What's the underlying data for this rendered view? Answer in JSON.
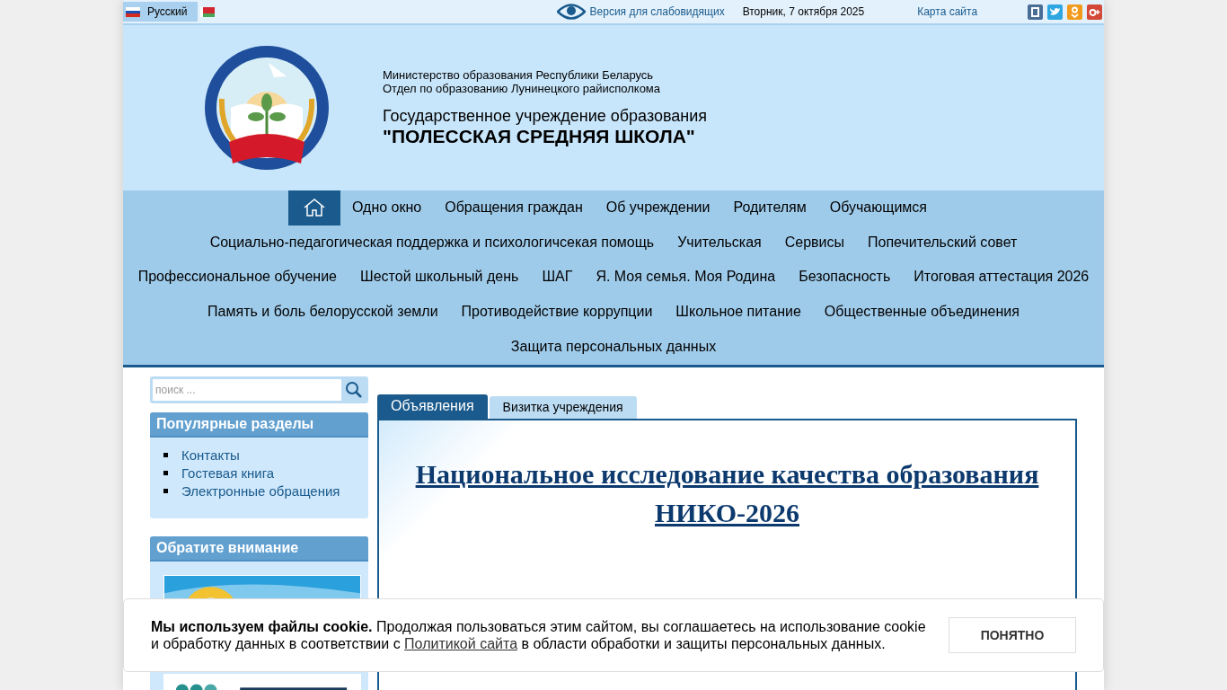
{
  "top_bar": {
    "languages": [
      {
        "label": "Русский",
        "selected": true
      },
      {
        "selected": false
      }
    ],
    "accessibility_link": "Версия для слабовидящих",
    "date": "Вторник, 7 октября 2025",
    "sitemap_link": "Карта сайта"
  },
  "header": {
    "ministry": "Министерство образования Республики Беларусь",
    "department": "Отдел по образованию Лунинецкого райисполкома",
    "institution": "Государственное учреждение образования",
    "school_name": "\"ПОЛЕССКАЯ СРЕДНЯЯ ШКОЛА\""
  },
  "nav": {
    "items": [
      {
        "kind": "home",
        "selected": true
      },
      {
        "label": "Одно окно",
        "selected": false
      },
      {
        "label": "Обращения граждан",
        "selected": false
      },
      {
        "label": "Об учреждении",
        "selected": false
      },
      {
        "label": "Родителям",
        "selected": false
      },
      {
        "label": "Обучающимся",
        "selected": false
      },
      {
        "label": "Социально-педагогическая поддержка и психологичсекая помощь",
        "selected": false
      },
      {
        "label": "Учительская",
        "selected": false
      },
      {
        "label": "Сервисы",
        "selected": false
      },
      {
        "label": "Попечительский совет",
        "selected": false
      },
      {
        "label": "Профессиональное обучение",
        "selected": false
      },
      {
        "label": "Шестой школьный день",
        "selected": false
      },
      {
        "label": "ШАГ",
        "selected": false
      },
      {
        "label": "Я. Моя семья. Моя Родина",
        "selected": false
      },
      {
        "label": "Безопасность",
        "selected": false
      },
      {
        "label": "Итоговая аттестация 2026",
        "selected": false
      },
      {
        "label": "Память и боль белорусской земли",
        "selected": false
      },
      {
        "label": "Противодействие коррупции",
        "selected": false
      },
      {
        "label": "Школьное питание",
        "selected": false
      },
      {
        "label": "Общественные объединения",
        "selected": false
      },
      {
        "label": "Защита персональных данных",
        "selected": false
      }
    ]
  },
  "sidebar": {
    "search": {
      "placeholder": "поиск ..."
    },
    "popular": {
      "title": "Популярные разделы",
      "links": [
        "Контакты",
        "Гостевая книга",
        "Электронные обращения"
      ]
    },
    "attention": {
      "title": "Обратите внимание"
    }
  },
  "main": {
    "tabs": [
      {
        "label": "Объявления",
        "selected": true
      },
      {
        "label": "Визитка учреждения",
        "selected": false
      }
    ],
    "headline": "Национальное исследование качества образования НИКО-2026"
  },
  "cookie_notice": {
    "text": "**Мы используем файлы cookie.** Продолжая пользоваться этим сайтом, вы соглашаетесь на использование cookie и обработку данных в соответствии с",
    "link": "Политикой сайта",
    "text_end": "в области обработки и защиты персональных данных.",
    "button": "ПОНЯТНО"
  }
}
